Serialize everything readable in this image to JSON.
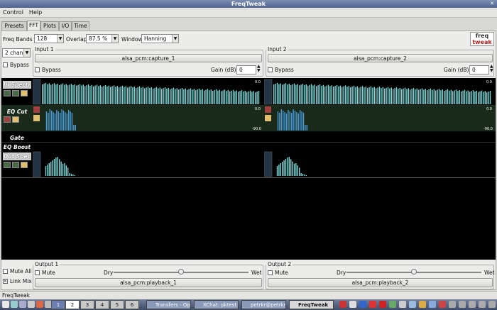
{
  "window": {
    "title": "FreqTweak"
  },
  "menu": [
    "Control",
    "Help"
  ],
  "tabs": [
    "Presets",
    "FFT",
    "Plots",
    "I/O",
    "Time"
  ],
  "toolbar": {
    "freq_bands_label": "Freq Bands",
    "freq_bands_value": "128",
    "overlap_label": "Overlap",
    "overlap_value": "87.5 %",
    "window_label": "Window",
    "window_value": "Hanning",
    "logo_top": "freq",
    "logo_bottom": "tweak"
  },
  "channels": {
    "value": "2 chan",
    "bypass_label": "Bypass"
  },
  "inputs": [
    {
      "title": "Input 1",
      "port": "alsa_pcm:capture_1",
      "bypass_label": "Bypass",
      "gain_label": "Gain (dB)",
      "gain_value": "0"
    },
    {
      "title": "Input 2",
      "port": "alsa_pcm:capture_2",
      "bypass_label": "Bypass",
      "gain_label": "Gain (dB)",
      "gain_value": "0"
    }
  ],
  "rows": {
    "in_spectra": "In Spectr",
    "eq_cut": "EQ Cut",
    "gate": "Gate",
    "eq_boost": "EQ Boost",
    "out_spectra": "Out Spec"
  },
  "eq_cut_scale": {
    "top": "0.0",
    "bottom": "-90.0"
  },
  "in_scale": {
    "top": "0.0"
  },
  "mute_all_label": "Mute All",
  "link_mix_label": "Link Mix",
  "outputs": [
    {
      "title": "Output 1",
      "mute_label": "Mute",
      "dry_label": "Dry",
      "wet_label": "Wet",
      "mix": 0.5,
      "port": "alsa_pcm:playback_1"
    },
    {
      "title": "Output 2",
      "mute_label": "Mute",
      "dry_label": "Dry",
      "wet_label": "Wet",
      "mix": 0.5,
      "port": "alsa_pcm:playback_2"
    }
  ],
  "status": "FreqTweak",
  "taskbar": {
    "workspaces": [
      "1",
      "2",
      "3",
      "4",
      "5",
      "6"
    ],
    "tasks": [
      "Transfers - Op...",
      "XChat: pktest",
      "petrkr@petrkr...",
      "FreqTweak"
    ]
  }
}
